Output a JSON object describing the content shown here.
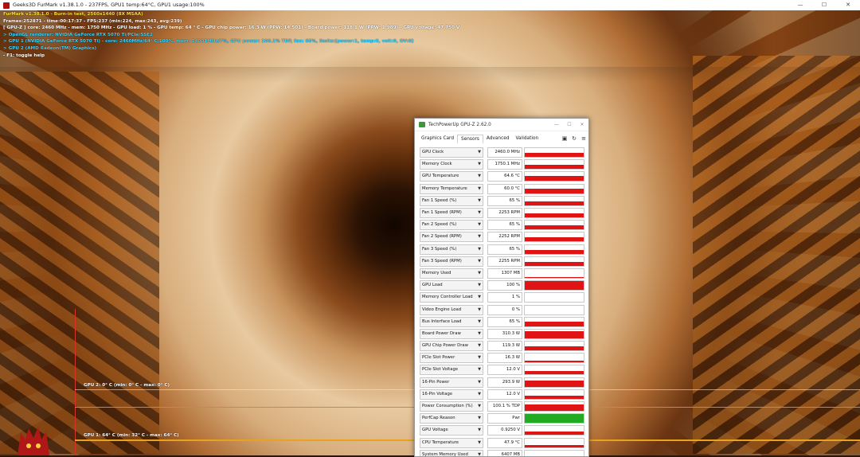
{
  "window": {
    "title": "Geeks3D FurMark v1.38.1.0 - 237FPS, GPU1 temp:64°C, GPU1 usage:100%",
    "minimize": "—",
    "maximize": "☐",
    "close": "✕"
  },
  "overlay": {
    "line1": "FurMark v1.38.1.0 - Burn-in test, 2560x1440 (8X MSAA)",
    "line2": "Frames:252871 - time:00:17:37 - FPS:237 (min:224, max:243, avg:239)",
    "line3": "[ GPU-Z ] core: 2460 MHz - mem: 1750 MHz - GPU load: 1 % - GPU temp: 64 ° C - GPU chip power: 16.3 W (PPW: 14.501) - Board power: 118.1 W (PPW: 1.989) - GPU voltage: 47.750 V",
    "line4": "> OpenGL renderer: NVIDIA GeForce RTX 5070 Ti/PCIe/SSE2",
    "line5": "> GPU 1 (NVIDIA GeForce RTX 5070 Ti) - core: 2460MHz/64° C/100%, mem: 14001MHz/7%, GPU power: 100.1% TDP, fan: 65%, limits:[power:1, temp:0, volt:0, OV:0]",
    "line6": "> GPU 2 (AMD Radeon(TM) Graphics)",
    "line7": "- F1: toggle help"
  },
  "graphs": {
    "gpu2_label": "GPU 2: 0° C (min: 0° C - max: 0° C)",
    "gpu1_label": "GPU 1: 64° C (min: 32° C - max: 64° C)"
  },
  "gpuz": {
    "title": "TechPowerUp GPU-Z 2.62.0",
    "tabs": [
      "Graphics Card",
      "Sensors",
      "Advanced",
      "Validation"
    ],
    "active_tab": "Sensors",
    "sensors": [
      {
        "name": "GPU Clock",
        "value": "2460.0 MHz",
        "level": 0.45
      },
      {
        "name": "Memory Clock",
        "value": "1750.1 MHz",
        "level": 0.45
      },
      {
        "name": "GPU Temperature",
        "value": "64.6 °C",
        "level": 0.5
      },
      {
        "name": "Memory Temperature",
        "value": "60.0 °C",
        "level": 0.5
      },
      {
        "name": "Fan 1 Speed (%)",
        "value": "65 %",
        "level": 0.45
      },
      {
        "name": "Fan 1 Speed (RPM)",
        "value": "2253 RPM",
        "level": 0.45
      },
      {
        "name": "Fan 2 Speed (%)",
        "value": "65 %",
        "level": 0.45
      },
      {
        "name": "Fan 2 Speed (RPM)",
        "value": "2252 RPM",
        "level": 0.45
      },
      {
        "name": "Fan 3 Speed (%)",
        "value": "65 %",
        "level": 0.45
      },
      {
        "name": "Fan 3 Speed (RPM)",
        "value": "2255 RPM",
        "level": 0.45
      },
      {
        "name": "Memory Used",
        "value": "1307 MB",
        "level": 0.1
      },
      {
        "name": "GPU Load",
        "value": "100 %",
        "level": 1.0
      },
      {
        "name": "Memory Controller Load",
        "value": "1 %",
        "level": 0.0
      },
      {
        "name": "Video Engine Load",
        "value": "0 %",
        "level": 0.0
      },
      {
        "name": "Bus Interface Load",
        "value": "65 %",
        "level": 0.5
      },
      {
        "name": "Board Power Draw",
        "value": "310.3 W",
        "level": 0.8
      },
      {
        "name": "GPU Chip Power Draw",
        "value": "119.3 W",
        "level": 0.45
      },
      {
        "name": "PCIe Slot Power",
        "value": "16.3 W",
        "level": 0.2
      },
      {
        "name": "PCIe Slot Voltage",
        "value": "12.0 V",
        "level": 0.35
      },
      {
        "name": "16-Pin Power",
        "value": "293.9 W",
        "level": 0.7
      },
      {
        "name": "16-Pin Voltage",
        "value": "12.0 V",
        "level": 0.35
      },
      {
        "name": "Power Consumption (%)",
        "value": "100.1 % TDP",
        "level": 0.7
      },
      {
        "name": "PerfCap Reason",
        "value": "Pwr",
        "level": 1.0,
        "color": "#22aa22"
      },
      {
        "name": "GPU Voltage",
        "value": "0.9250 V",
        "level": 0.35
      },
      {
        "name": "CPU Temperature",
        "value": "47.9 °C",
        "level": 0.3
      },
      {
        "name": "System Memory Used",
        "value": "6407 MB",
        "level": 0.3
      }
    ]
  },
  "colors": {
    "sensor_bar": "#e01414",
    "perfcap_bar": "#22aa22",
    "overlay_yellow": "#ffe13a",
    "overlay_cyan": "#3fd6ff",
    "gpu1_graph": "#e8a21e",
    "gpu2_graph": "#3fb6c6"
  }
}
